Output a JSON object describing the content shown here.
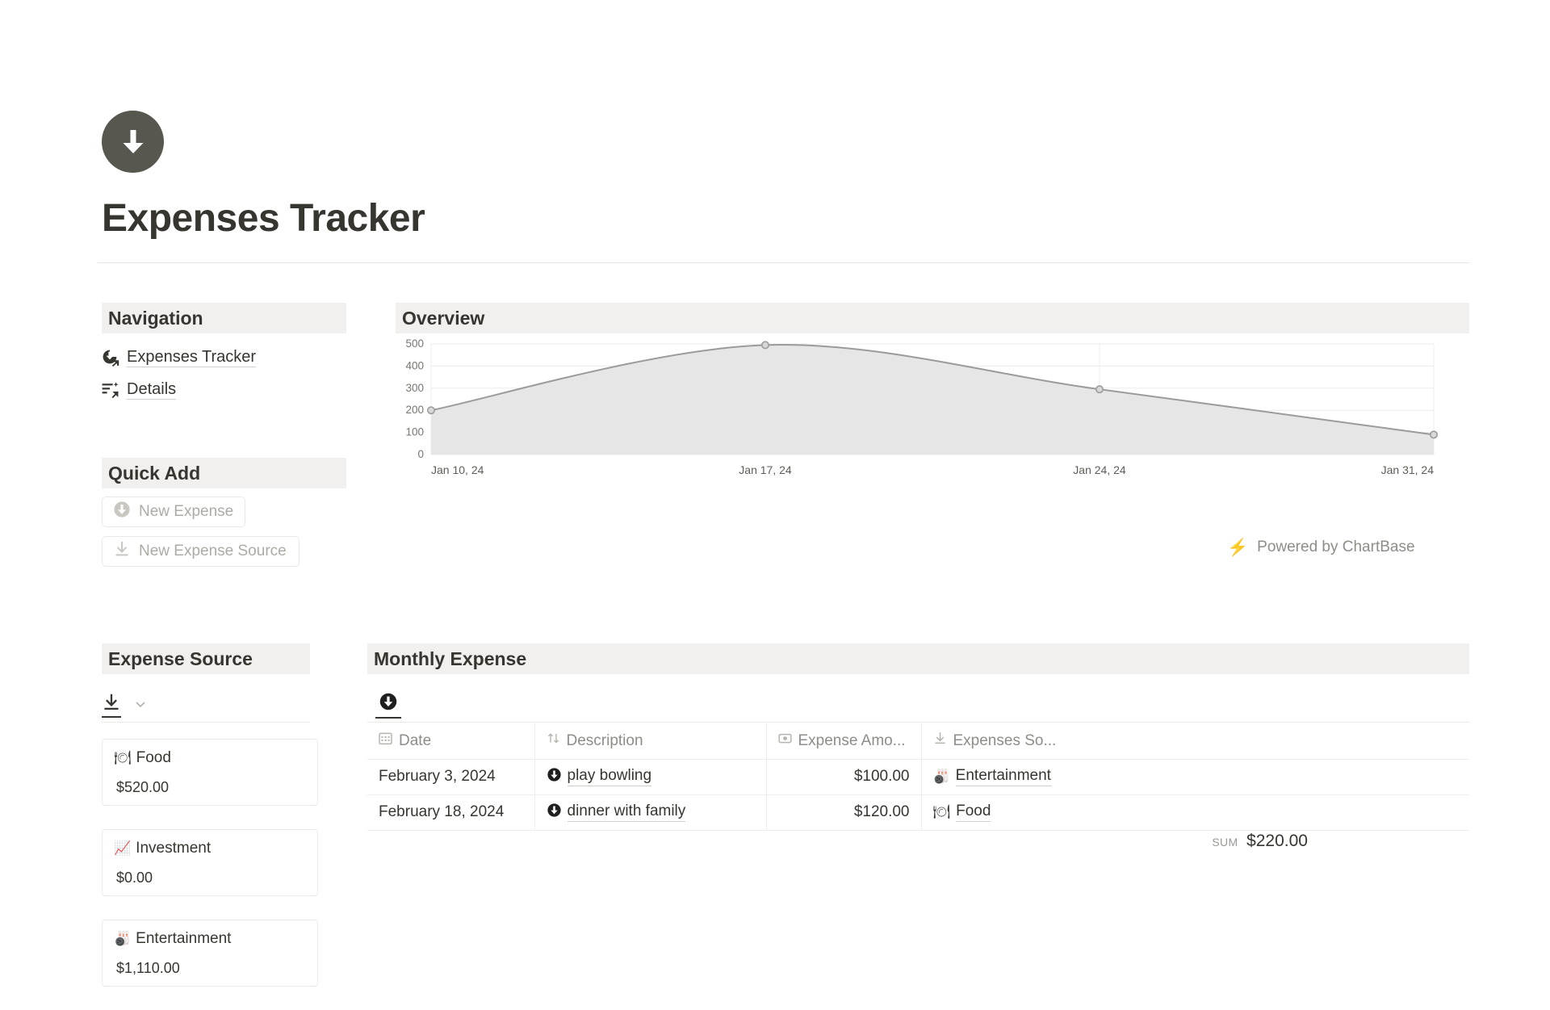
{
  "header": {
    "icon": "circle-down-arrow-icon",
    "title": "Expenses Tracker",
    "icon_bg": "#57564f"
  },
  "sidebar": {
    "navigation": {
      "title": "Navigation",
      "items": [
        {
          "label": "Expenses Tracker",
          "icon": "expense-link-icon"
        },
        {
          "label": "Details",
          "icon": "details-link-icon"
        }
      ]
    },
    "quick_add": {
      "title": "Quick Add",
      "buttons": [
        {
          "label": "New Expense",
          "icon": "circle-down-arrow-icon"
        },
        {
          "label": "New Expense Source",
          "icon": "download-icon"
        }
      ]
    },
    "expense_source": {
      "title": "Expense Source",
      "tab_icon": "download-icon",
      "chevron_icon": "chevron-down-icon",
      "cards": [
        {
          "emoji": "🍽",
          "name": "Food",
          "amount": "$520.00"
        },
        {
          "emoji": "📈",
          "name": "Investment",
          "amount": "$0.00"
        },
        {
          "emoji": "🎳",
          "name": "Entertainment",
          "amount": "$1,110.00"
        }
      ]
    }
  },
  "overview": {
    "title": "Overview",
    "powered_by": "Powered by ChartBase",
    "bolt_icon": "lightning-bolt-icon",
    "bolt_color": "#f5a623"
  },
  "chart_data": {
    "type": "area",
    "title": "Overview",
    "x": [
      "Jan 10, 24",
      "Jan 17, 24",
      "Jan 24, 24",
      "Jan 31, 24"
    ],
    "values": [
      200,
      495,
      295,
      90
    ],
    "xlabel": "",
    "ylabel": "",
    "ylim": [
      0,
      500
    ],
    "yticks": [
      0,
      100,
      200,
      300,
      400,
      500
    ],
    "grid": true,
    "legend": false,
    "line_color": "#9b9b9b",
    "fill_color": "#e6e6e6",
    "smooth": true
  },
  "monthly_expense": {
    "title": "Monthly Expense",
    "tab_icon": "circle-down-arrow-icon",
    "columns": [
      {
        "label": "Date",
        "icon": "calendar-icon"
      },
      {
        "label": "Description",
        "icon": "sort-icon"
      },
      {
        "label": "Expense Amo...",
        "icon": "money-icon"
      },
      {
        "label": "Expenses So...",
        "icon": "download-icon"
      }
    ],
    "rows": [
      {
        "date": "February 3, 2024",
        "description": "play bowling",
        "amount": "$100.00",
        "source": "Entertainment",
        "source_emoji": "🎳"
      },
      {
        "date": "February 18, 2024",
        "description": "dinner with family",
        "amount": "$120.00",
        "source": "Food",
        "source_emoji": "🍽"
      }
    ],
    "sum_label": "SUM",
    "sum_value": "$220.00"
  }
}
